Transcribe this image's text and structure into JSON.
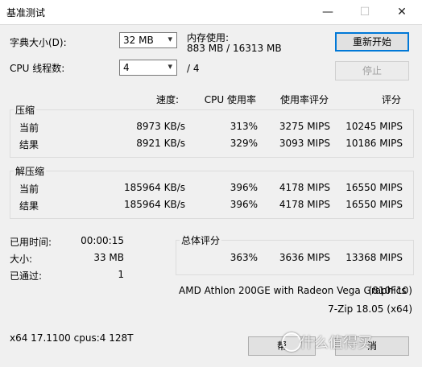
{
  "window": {
    "title": "基准测试",
    "min_icon": "—",
    "max_icon": "☐",
    "close_icon": "✕"
  },
  "settings": {
    "dict_label": "字典大小(D):",
    "dict_value": "32 MB",
    "threads_label": "CPU 线程数:",
    "threads_value": "4",
    "threads_total": "/ 4",
    "memory_label": "内存使用:",
    "memory_value": "883 MB / 16313 MB"
  },
  "buttons": {
    "restart": "重新开始",
    "stop": "停止",
    "help": "帮",
    "cancel": "消"
  },
  "headers": {
    "speed": "速度:",
    "cpu": "CPU 使用率",
    "rating_per_use": "使用率评分",
    "rating": "评分"
  },
  "compress": {
    "title": "压缩",
    "rows": [
      {
        "name": "当前",
        "speed": "8973 KB/s",
        "cpu": "313%",
        "rpu": "3275 MIPS",
        "rating": "10245 MIPS"
      },
      {
        "name": "结果",
        "speed": "8921 KB/s",
        "cpu": "329%",
        "rpu": "3093 MIPS",
        "rating": "10186 MIPS"
      }
    ]
  },
  "decompress": {
    "title": "解压缩",
    "rows": [
      {
        "name": "当前",
        "speed": "185964 KB/s",
        "cpu": "396%",
        "rpu": "4178 MIPS",
        "rating": "16550 MIPS"
      },
      {
        "name": "结果",
        "speed": "185964 KB/s",
        "cpu": "396%",
        "rpu": "4178 MIPS",
        "rating": "16550 MIPS"
      }
    ]
  },
  "stats": {
    "elapsed_label": "已用时间:",
    "elapsed_value": "00:00:15",
    "size_label": "大小:",
    "size_value": "33 MB",
    "passes_label": "已通过:",
    "passes_value": "1"
  },
  "total": {
    "title": "总体评分",
    "cpu": "363%",
    "rpu": "3636 MIPS",
    "rating": "13368 MIPS"
  },
  "cpu_info": {
    "name": "AMD Athlon 200GE with Radeon Vega Graphics",
    "id": "(810F10)"
  },
  "version": "7-Zip 18.05 (x64)",
  "sysinfo": "x64 17.1100 cpus:4 128T",
  "watermark": "什么值得买"
}
